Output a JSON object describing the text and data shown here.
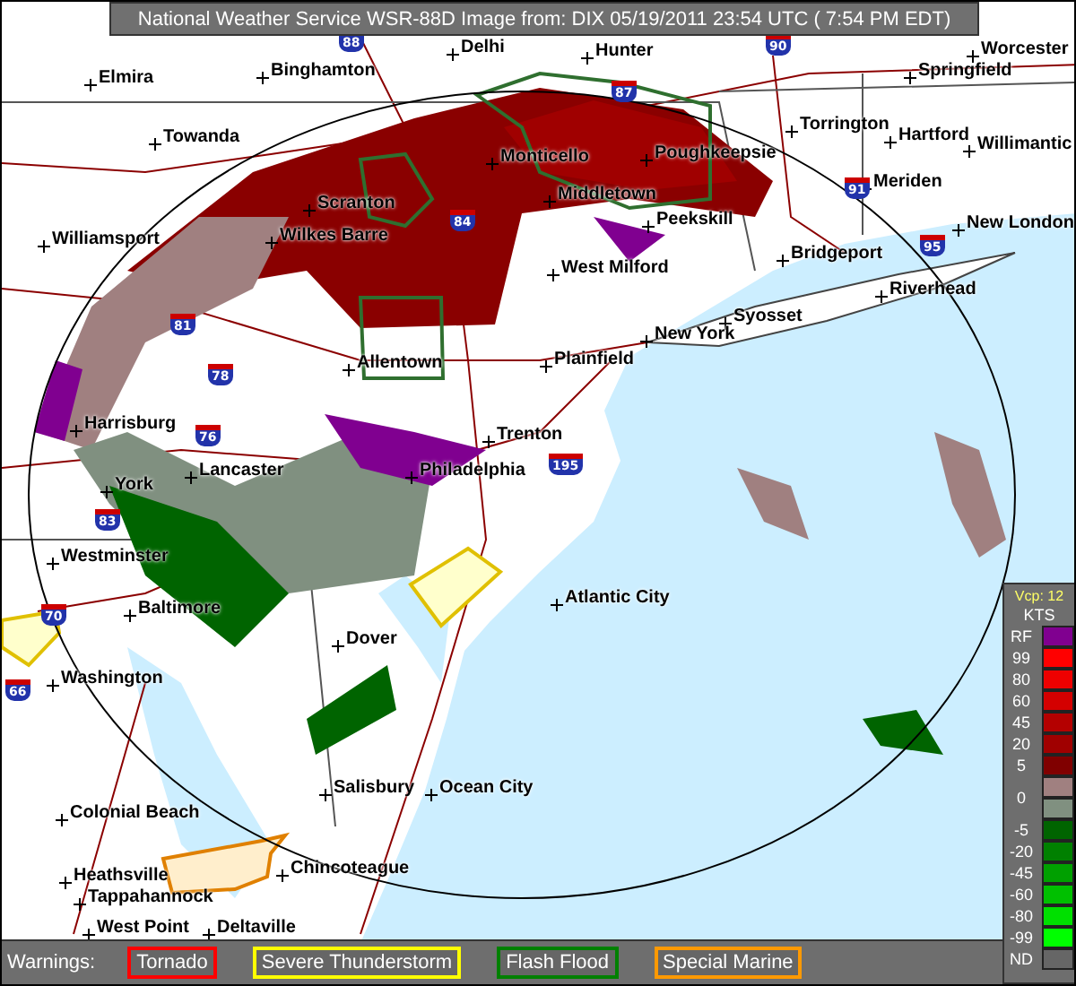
{
  "header": {
    "title": "National Weather Service WSR-88D Image from: DIX 05/19/2011 23:54 UTC ( 7:54 PM EDT)"
  },
  "map": {
    "cities": [
      {
        "name": "Delhi"
      },
      {
        "name": "Hunter"
      },
      {
        "name": "Worcester"
      },
      {
        "name": "Elmira"
      },
      {
        "name": "Binghamton"
      },
      {
        "name": "Springfield"
      },
      {
        "name": "Towanda"
      },
      {
        "name": "Torrington"
      },
      {
        "name": "Hartford"
      },
      {
        "name": "Willimantic"
      },
      {
        "name": "Monticello"
      },
      {
        "name": "Poughkeepsie"
      },
      {
        "name": "Meriden"
      },
      {
        "name": "Middletown"
      },
      {
        "name": "Scranton"
      },
      {
        "name": "New London"
      },
      {
        "name": "Williamsport"
      },
      {
        "name": "Wilkes Barre"
      },
      {
        "name": "Peekskill"
      },
      {
        "name": "Bridgeport"
      },
      {
        "name": "West Milford"
      },
      {
        "name": "Riverhead"
      },
      {
        "name": "Syosset"
      },
      {
        "name": "New York"
      },
      {
        "name": "Plainfield"
      },
      {
        "name": "Allentown"
      },
      {
        "name": "Harrisburg"
      },
      {
        "name": "Trenton"
      },
      {
        "name": "Lancaster"
      },
      {
        "name": "Philadelphia"
      },
      {
        "name": "York"
      },
      {
        "name": "Westminster"
      },
      {
        "name": "Atlantic City"
      },
      {
        "name": "Baltimore"
      },
      {
        "name": "Dover"
      },
      {
        "name": "Washington"
      },
      {
        "name": "Salisbury"
      },
      {
        "name": "Ocean City"
      },
      {
        "name": "Colonial Beach"
      },
      {
        "name": "Heathsville"
      },
      {
        "name": "Chincoteague"
      },
      {
        "name": "Tappahannock"
      },
      {
        "name": "West Point"
      },
      {
        "name": "Deltaville"
      }
    ],
    "interstates": [
      {
        "number": "88"
      },
      {
        "number": "90"
      },
      {
        "number": "87"
      },
      {
        "number": "84"
      },
      {
        "number": "91"
      },
      {
        "number": "95"
      },
      {
        "number": "81"
      },
      {
        "number": "78"
      },
      {
        "number": "76"
      },
      {
        "number": "195"
      },
      {
        "number": "83"
      },
      {
        "number": "70"
      },
      {
        "number": "66"
      }
    ]
  },
  "legend": {
    "vcp": "Vcp: 12",
    "unit": "KTS",
    "entries": [
      {
        "label": "RF",
        "color": "#800090"
      },
      {
        "label": "99",
        "color": "#ff0000"
      },
      {
        "label": "80",
        "color": "#ee0000"
      },
      {
        "label": "60",
        "color": "#d40000"
      },
      {
        "label": "45",
        "color": "#b40000"
      },
      {
        "label": "20",
        "color": "#a00000"
      },
      {
        "label": "5",
        "color": "#800000"
      },
      {
        "label": "0",
        "color": "#a08080"
      },
      {
        "color": "#809080"
      },
      {
        "label": "-5",
        "color": "#006400"
      },
      {
        "label": "-20",
        "color": "#008000"
      },
      {
        "label": "-45",
        "color": "#00a000"
      },
      {
        "label": "-60",
        "color": "#00c000"
      },
      {
        "label": "-80",
        "color": "#00e000"
      },
      {
        "label": "-99",
        "color": "#00ff00"
      },
      {
        "label": "ND",
        "color": "#666666"
      }
    ]
  },
  "warnings": {
    "label": "Warnings:",
    "items": [
      {
        "name": "Tornado",
        "color": "#ff0000"
      },
      {
        "name": "Severe Thunderstorm",
        "color": "#ffff00"
      },
      {
        "name": "Flash Flood",
        "color": "#008000"
      },
      {
        "name": "Special Marine",
        "color": "#ff9900"
      }
    ]
  }
}
